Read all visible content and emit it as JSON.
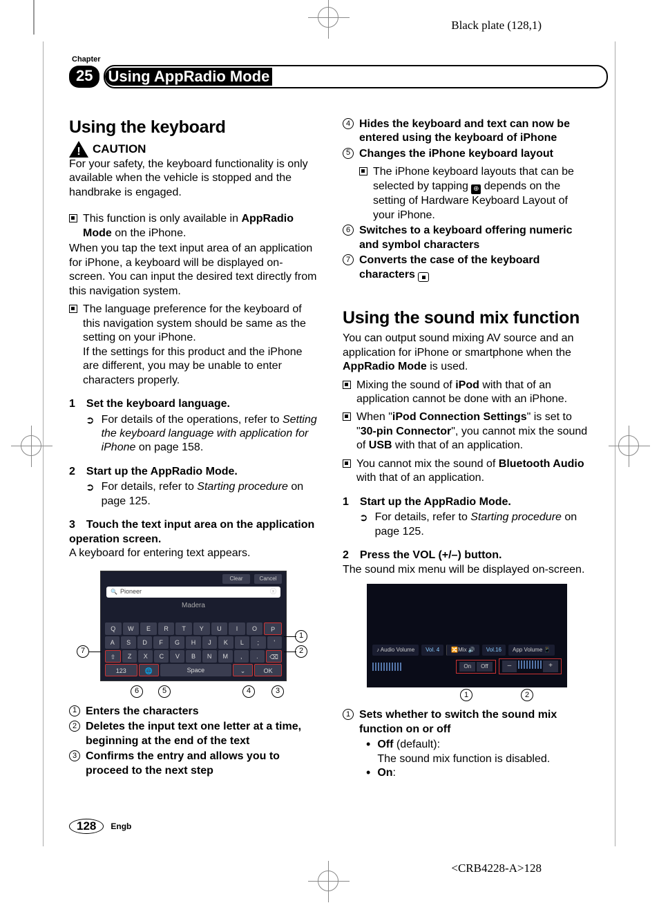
{
  "meta": {
    "black_plate": "Black plate (128,1)",
    "bottom_code": "<CRB4228-A>128"
  },
  "header": {
    "chapter_label": "Chapter",
    "chapter_number": "25",
    "title": "Using AppRadio Mode"
  },
  "left": {
    "h2": "Using the keyboard",
    "caution": "CAUTION",
    "caution_p": "For your safety, the keyboard functionality is only available when the vehicle is stopped and the handbrake is engaged.",
    "note1_pre": "This function is only available in ",
    "note1_bold": "AppRadio Mode",
    "note1_post": " on the iPhone.",
    "p2": "When you tap the text input area of an application for iPhone, a keyboard will be displayed on-screen. You can input the desired text directly from this navigation system.",
    "note2a": "The language preference for the keyboard of this navigation system should be same as the setting on your iPhone.",
    "note2b": "If the settings for this product and the iPhone are different, you may be unable to enter characters properly.",
    "step1_num": "1",
    "step1": "Set the keyboard language.",
    "step1_sub_pre": "For details of the operations, refer to ",
    "step1_sub_em": "Setting the keyboard language with application for iPhone",
    "step1_sub_post": " on page 158.",
    "step2_num": "2",
    "step2": "Start up the AppRadio Mode.",
    "step2_sub_pre": "For details, refer to ",
    "step2_sub_em": "Starting procedure",
    "step2_sub_post": " on page 125.",
    "step3_num": "3",
    "step3": "Touch the text input area on the application operation screen.",
    "step3_p": "A keyboard for entering text appears.",
    "kb": {
      "clear": "Clear",
      "cancel": "Cancel",
      "search": "Pioneer",
      "mid": "Madera",
      "row1": [
        "Q",
        "W",
        "E",
        "R",
        "T",
        "Y",
        "U",
        "I",
        "O",
        "P"
      ],
      "row2": [
        "A",
        "S",
        "D",
        "F",
        "G",
        "H",
        "J",
        "K",
        "L",
        ";",
        "'"
      ],
      "row3": [
        "⇧",
        "Z",
        "X",
        "C",
        "V",
        "B",
        "N",
        "M",
        ",",
        ".",
        "⌫"
      ],
      "row4_123": "123",
      "row4_space": "Space",
      "row4_ok": "OK"
    },
    "legend": {
      "l1": "Enters the characters",
      "l2": "Deletes the input text one letter at a time, beginning at the end of the text",
      "l3": "Confirms the entry and allows you to proceed to the next step"
    }
  },
  "right": {
    "cont4": "Hides the keyboard and text can now be entered using the keyboard of iPhone",
    "cont5": "Changes the iPhone keyboard layout",
    "cont5_sub_a": "The iPhone keyboard layouts that can be selected by tapping ",
    "cont5_sub_b": " depends on the setting of Hardware Keyboard Layout of your iPhone.",
    "cont6": "Switches to a keyboard offering numeric and symbol characters",
    "cont7": "Converts the case of the keyboard characters",
    "h2": "Using the sound mix function",
    "p1_a": "You can output sound mixing AV source and an application for iPhone or smartphone when the ",
    "p1_bold": "AppRadio Mode",
    "p1_b": " is used.",
    "n1_a": "Mixing the sound of ",
    "n1_bold": "iPod",
    "n1_b": " with that of an application cannot be done with an iPhone.",
    "n2_a": "When \"",
    "n2_b1": "iPod Connection Settings",
    "n2_c": "\" is set to \"",
    "n2_b2": "30-pin Connector",
    "n2_d": "\", you cannot mix the sound of ",
    "n2_b3": "USB",
    "n2_e": " with that of an application.",
    "n3_a": "You cannot mix the sound of ",
    "n3_bold": "Bluetooth Audio",
    "n3_b": " with that of an application.",
    "step1_num": "1",
    "step1": "Start up the AppRadio Mode.",
    "step1_sub_pre": "For details, refer to ",
    "step1_sub_em": "Starting procedure",
    "step1_sub_post": " on page 125.",
    "step2_num": "2",
    "step2": "Press the VOL (+/–) button.",
    "step2_p": "The sound mix menu will be displayed on-screen.",
    "mix": {
      "audio_vol_label": "♪ Audio Volume",
      "audio_vol_val": "Vol. 4",
      "mix_label": "🔀Mix 🔊",
      "app_vol_val": "Vol.16",
      "app_vol_label": "App Volume 📱",
      "on": "On",
      "off": "Off",
      "minus": "–",
      "plus": "+"
    },
    "legend1": "Sets whether to switch the sound mix function on or off",
    "legend1_off_a": "Off",
    "legend1_off_b": " (default):",
    "legend1_off_c": "The sound mix function is disabled.",
    "legend1_on": "On",
    "legend1_on_colon": ":"
  },
  "footer": {
    "page": "128",
    "engb": "Engb"
  }
}
